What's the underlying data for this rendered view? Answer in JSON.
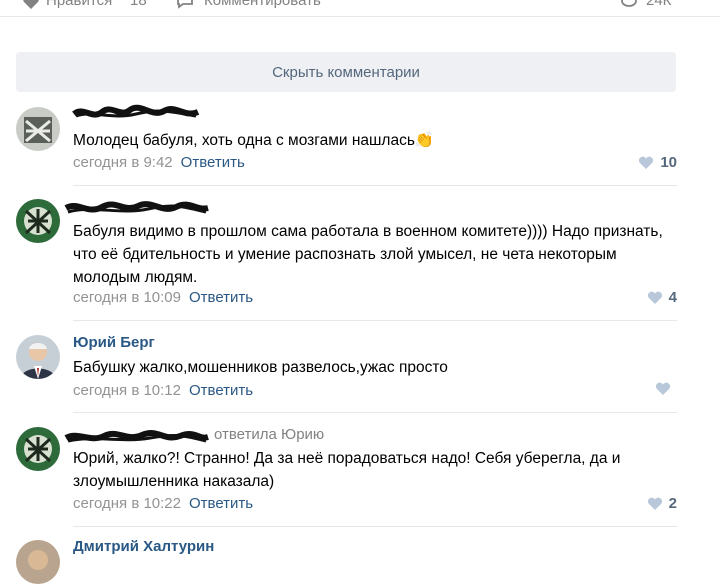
{
  "post_actions": {
    "like_label": "Нравится",
    "like_count": "18",
    "comment_label": "Комментировать",
    "views": "24К"
  },
  "hide_comments_label": "Скрыть комментарии",
  "comments": [
    {
      "author": "",
      "text": "Молодец бабуля, хоть одна с мозгами нашлась👏",
      "time": "сегодня в 9:42",
      "reply_label": "Ответить",
      "likes": "10"
    },
    {
      "author": "",
      "text": "Бабуля видимо в прошлом сама работала в военном комитете)))) Надо признать, что её бдительность и умение распознать злой умысел, не чета некоторым молодым людям.",
      "time": "сегодня в 10:09",
      "reply_label": "Ответить",
      "likes": "4"
    },
    {
      "author": "Юрий Берг",
      "text": "Бабушку жалко,мошенников развелось,ужас просто",
      "time": "сегодня в 10:12",
      "reply_label": "Ответить",
      "likes": ""
    },
    {
      "author": "",
      "replied_to": "ответила Юрию",
      "text": "Юрий, жалко?! Странно! Да за неё порадоваться надо! Себя уберегла, да и злоумышленника наказала)",
      "time": "сегодня в 10:22",
      "reply_label": "Ответить",
      "likes": "2"
    },
    {
      "author": "Дмитрий Халтурин"
    }
  ],
  "colors": {
    "link": "#2a5885",
    "meta": "#939393",
    "like_icon": "#b8c7d9",
    "button_bg": "#eef0f3"
  },
  "icons": [
    "heart-icon",
    "comment-icon",
    "eye-icon",
    "clap-emoji"
  ]
}
